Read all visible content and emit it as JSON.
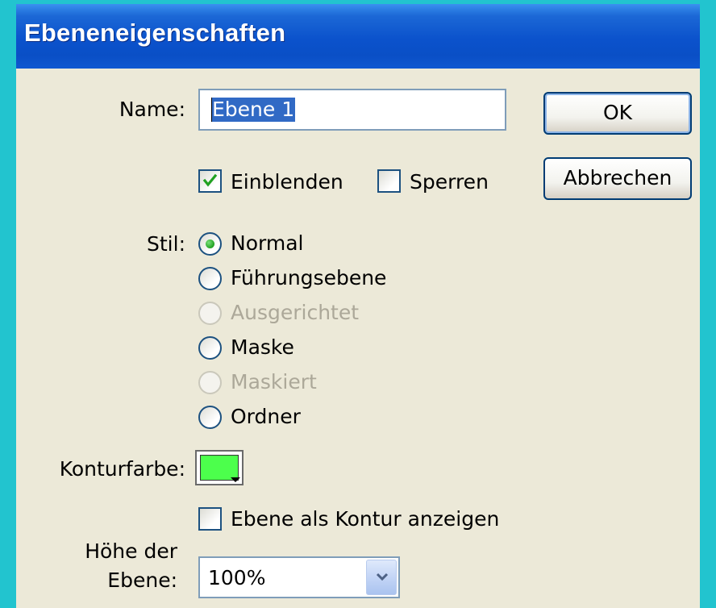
{
  "window": {
    "title": "Ebeneneigenschaften"
  },
  "name_field": {
    "label": "Name:",
    "value": "Ebene 1"
  },
  "buttons": {
    "ok": "OK",
    "cancel": "Abbrechen"
  },
  "visibility": {
    "show": {
      "label": "Einblenden",
      "checked": true
    },
    "lock": {
      "label": "Sperren",
      "checked": false
    }
  },
  "style": {
    "label": "Stil:",
    "options": [
      {
        "label": "Normal",
        "selected": true,
        "enabled": true
      },
      {
        "label": "Führungsebene",
        "selected": false,
        "enabled": true
      },
      {
        "label": "Ausgerichtet",
        "selected": false,
        "enabled": false
      },
      {
        "label": "Maske",
        "selected": false,
        "enabled": true
      },
      {
        "label": "Maskiert",
        "selected": false,
        "enabled": false
      },
      {
        "label": "Ordner",
        "selected": false,
        "enabled": true
      }
    ]
  },
  "outline_color": {
    "label": "Konturfarbe:",
    "color": "#4cff4c"
  },
  "outline_view": {
    "label": "Ebene als Kontur anzeigen",
    "checked": false
  },
  "layer_height": {
    "label_line1": "Höhe der",
    "label_line2": "Ebene:",
    "value": "100%"
  }
}
